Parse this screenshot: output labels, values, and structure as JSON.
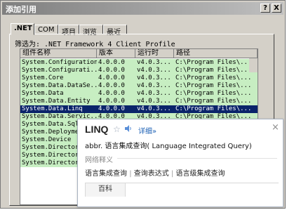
{
  "window": {
    "title": "添加引用",
    "help_button": "?",
    "close_button": "X"
  },
  "tabs": [
    ".NET",
    "COM",
    "项目",
    "浏览",
    "最近"
  ],
  "filter_text": "筛选为: .NET Framework 4 Client Profile",
  "columns": [
    "组件名称",
    "版本",
    "运行时",
    "路径"
  ],
  "rows": [
    {
      "name": "System.Configuration",
      "version": "4.0.0.0",
      "runtime": "v4.0.3...",
      "path": "C:\\Program Files\\..."
    },
    {
      "name": "System.Configurati...",
      "version": "4.0.0.0",
      "runtime": "v4.0.3...",
      "path": "C:\\Program Files\\..."
    },
    {
      "name": "System.Core",
      "version": "4.0.0.0",
      "runtime": "v4.0.3...",
      "path": "C:\\Program Files\\..."
    },
    {
      "name": "System.Data.DataSe...",
      "version": "4.0.0.0",
      "runtime": "v4.0.3...",
      "path": "C:\\Program Files\\..."
    },
    {
      "name": "System.Data",
      "version": "4.0.0.0",
      "runtime": "v4.0.3...",
      "path": "C:\\Program Files\\..."
    },
    {
      "name": "System.Data.Entity",
      "version": "4.0.0.0",
      "runtime": "v4.0.3...",
      "path": "C:\\Program Files\\..."
    },
    {
      "name": "System.Data.Linq",
      "version": "4.0.0.0",
      "runtime": "v4.0.3...",
      "path": "C:\\Program Files\\..."
    },
    {
      "name": "System.Data.Servic...",
      "version": "4.0.0.0",
      "runtime": "v4.0.3...",
      "path": "C:\\Program Files\\..."
    },
    {
      "name": "System.Data.SqlXm",
      "version": "",
      "runtime": "",
      "path": ""
    },
    {
      "name": "System.Deployment",
      "version": "",
      "runtime": "",
      "path": ""
    },
    {
      "name": "System.Device",
      "version": "",
      "runtime": "",
      "path": ""
    },
    {
      "name": "System.Directory",
      "version": "",
      "runtime": "",
      "path": ""
    },
    {
      "name": "System.Directory",
      "version": "",
      "runtime": "",
      "path": ""
    },
    {
      "name": "System.Directory",
      "version": "",
      "runtime": "",
      "path": ""
    }
  ],
  "selected_row": 6,
  "popup": {
    "word": "LINQ",
    "detail_link": "详细»",
    "close": "×",
    "definition": "abbr. 语言集成查询( Language Integrated Query)",
    "section_title": "网络释义",
    "net_meanings": [
      "语言集成查询",
      "查询表达式",
      "语言级集成查询"
    ],
    "separator": "|",
    "baike_tab": "百科"
  },
  "colors": {
    "row_bg": "#c7eec2",
    "selected_bg": "#0a246a",
    "dialog_bg": "#d4d0c8",
    "link": "#1a5fb4"
  }
}
